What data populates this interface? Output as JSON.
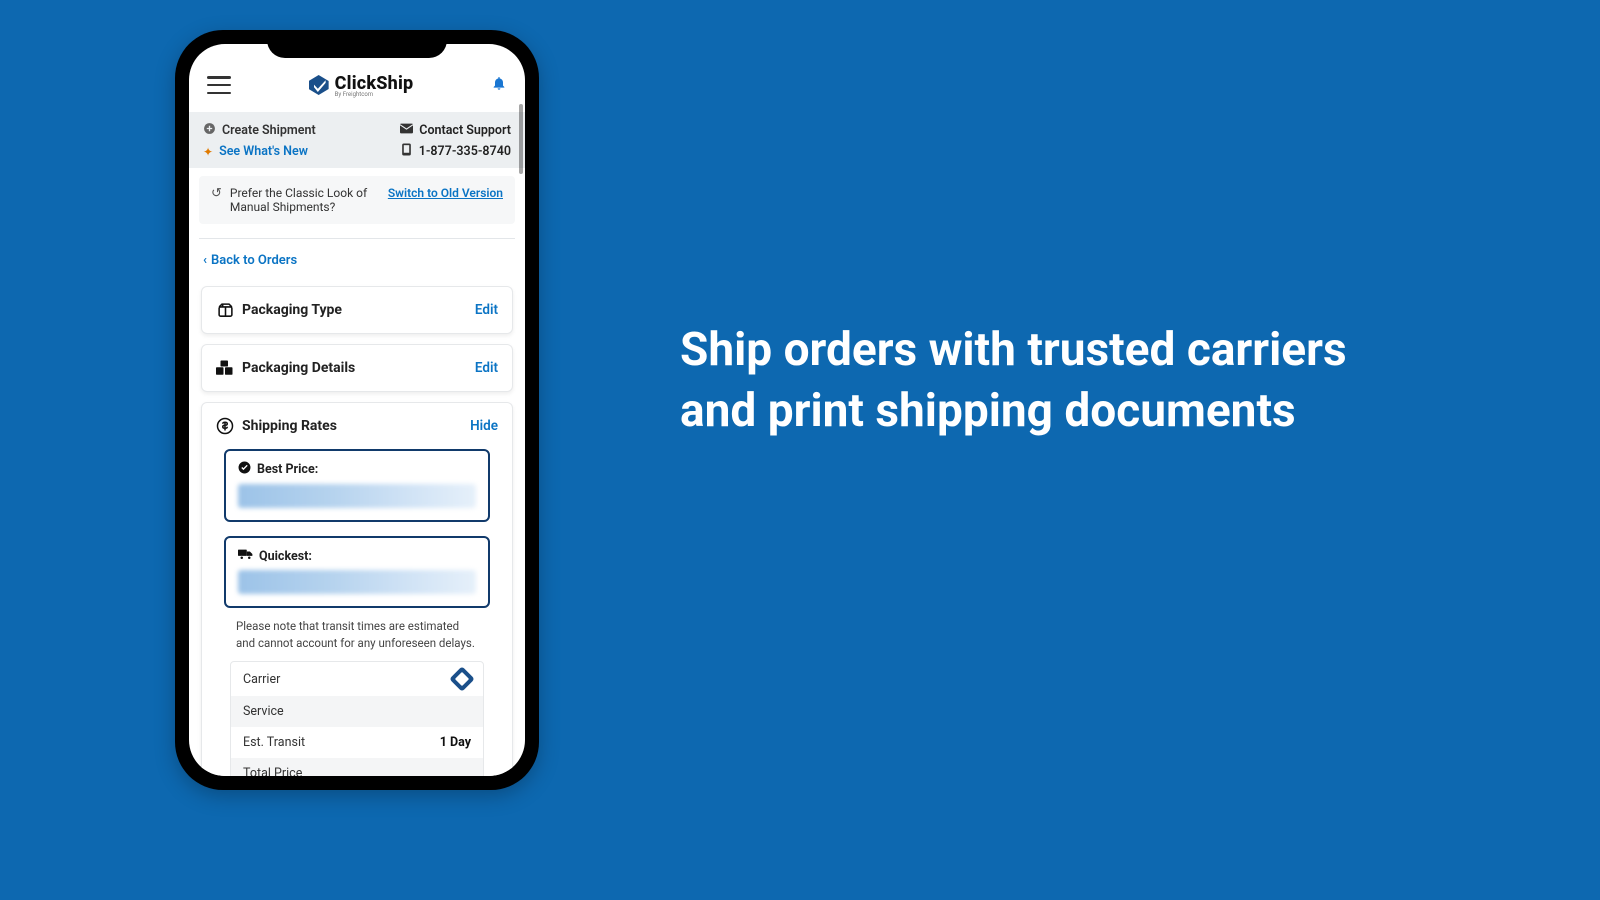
{
  "headline": "Ship orders with trusted carriers and print shipping documents",
  "logo": {
    "click": "Click",
    "ship": "Ship",
    "byline": "By Freightcom"
  },
  "graybar": {
    "create_shipment": "Create Shipment",
    "see_whats_new": "See What's New",
    "contact_support": "Contact Support",
    "phone": "1-877-335-8740"
  },
  "classic": {
    "text_line1": "Prefer the Classic Look of",
    "text_line2": "Manual Shipments?",
    "switch": "Switch to Old Version"
  },
  "back_label": "Back to Orders",
  "cards": {
    "packaging_type": {
      "title": "Packaging Type",
      "action": "Edit"
    },
    "packaging_details": {
      "title": "Packaging Details",
      "action": "Edit"
    },
    "shipping_rates": {
      "title": "Shipping Rates",
      "action": "Hide"
    }
  },
  "rates": {
    "best_price_label": "Best Price:",
    "quickest_label": "Quickest:",
    "note": "Please note that transit times are estimated and cannot account for any unforeseen delays.",
    "table": {
      "carrier": "Carrier",
      "service": "Service",
      "transit_label": "Est. Transit",
      "transit_value": "1 Day",
      "total_price": "Total Price"
    }
  }
}
